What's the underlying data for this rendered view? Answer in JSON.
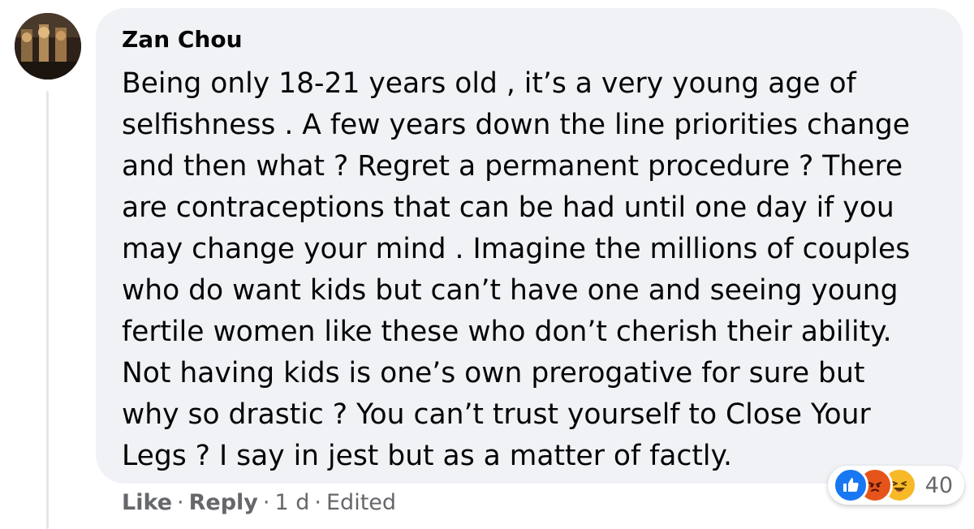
{
  "comment": {
    "author": "Zan Chou",
    "body_lines": [
      "Being only 18-21 years old , it’s a very young age of",
      "selfishness . A few years down the line priorities change",
      "and then what ? Regret a permanent procedure ? There",
      "are contraceptions that can be had until one day if you",
      "may change your mind . Imagine the millions of couples",
      "who do want kids but can’t have one and seeing young",
      "fertile women like these who don’t cherish their ability.",
      "Not having kids is one’s own prerogative for sure but",
      "why so drastic ? You can’t trust yourself to Close Your",
      "Legs ? I say in jest but as a matter of factly."
    ],
    "reactions": {
      "icons": [
        "like-icon",
        "angry-icon",
        "haha-icon"
      ],
      "count": "40"
    },
    "actions": {
      "like": "Like",
      "reply": "Reply",
      "separator": "·",
      "time": "1 d",
      "edited": "Edited"
    }
  },
  "colors": {
    "bubble_bg": "#f0f2f5",
    "text": "#050505",
    "meta_text": "#65676b",
    "like_blue": "#1877f2",
    "angry_orange": "#e5541b",
    "haha_yellow": "#f7b928"
  }
}
